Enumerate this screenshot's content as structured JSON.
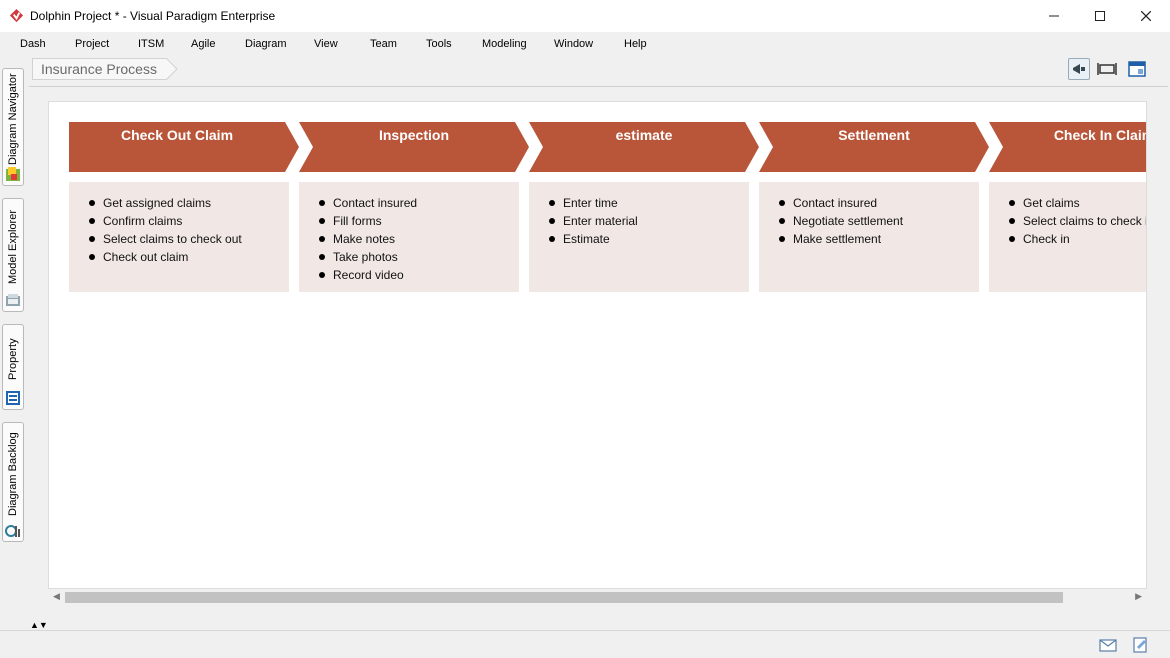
{
  "window": {
    "title": "Dolphin Project * - Visual Paradigm Enterprise",
    "controls": {
      "minimize": "—",
      "maximize": "☐",
      "close": "✕"
    }
  },
  "menu": [
    "Dash",
    "Project",
    "ITSM",
    "Agile",
    "Diagram",
    "View",
    "Team",
    "Tools",
    "Modeling",
    "Window",
    "Help"
  ],
  "left_tabs": [
    {
      "label": "Diagram Navigator",
      "icon": "diagram-navigator-icon"
    },
    {
      "label": "Model Explorer",
      "icon": "model-explorer-icon"
    },
    {
      "label": "Property",
      "icon": "property-icon"
    },
    {
      "label": "Diagram Backlog",
      "icon": "diagram-backlog-icon"
    }
  ],
  "breadcrumb": "Insurance Process",
  "toolbar_icons": [
    "announce-icon",
    "fit-diagram-icon",
    "diagram-overview-icon"
  ],
  "colors": {
    "stage_head": "#b9563a",
    "stage_body": "#f1e8e5"
  },
  "stages": [
    {
      "title": "Check Out Claim",
      "items": [
        "Get assigned claims",
        "Confirm claims",
        "Select claims to check out",
        "Check out claim"
      ]
    },
    {
      "title": "Inspection",
      "items": [
        "Contact insured",
        "Fill forms",
        "Make notes",
        "Take photos",
        "Record video"
      ]
    },
    {
      "title": "estimate",
      "items": [
        "Enter time",
        "Enter material",
        "Estimate"
      ]
    },
    {
      "title": "Settlement",
      "items": [
        "Contact insured",
        "Negotiate settlement",
        "Make settlement"
      ]
    },
    {
      "title": "Check In Claim",
      "items": [
        "Get claims",
        "Select claims to check in",
        "Check in"
      ]
    }
  ],
  "status_icons": [
    "mail-icon",
    "edit-note-icon"
  ]
}
